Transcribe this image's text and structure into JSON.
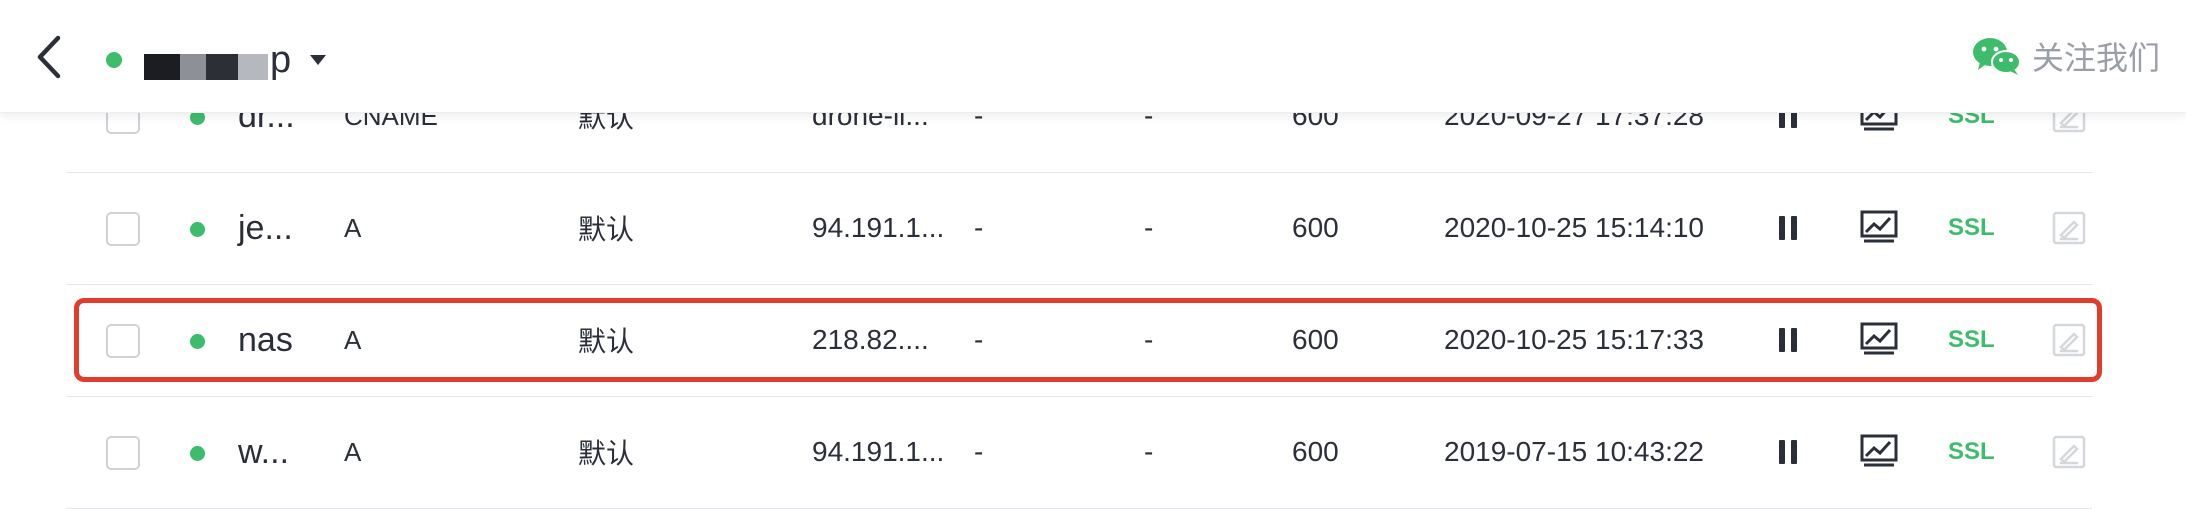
{
  "header": {
    "back_icon": "chevron-left-icon",
    "domain_status_color": "#3dbd6c",
    "domain_visible_suffix": "p",
    "dropdown_icon": "caret-down-icon",
    "follow_icon": "wechat-icon",
    "follow_label": "关注我们"
  },
  "records": [
    {
      "host": "dr...",
      "type": "CNAME",
      "line": "默认",
      "value": "drone-li...",
      "mx": "-",
      "weight": "-",
      "ttl": "600",
      "updated": "2020-09-27 17:37:28",
      "status": "enabled",
      "ssl": "SSL"
    },
    {
      "host": "je...",
      "type": "A",
      "line": "默认",
      "value": "94.191.1...",
      "mx": "-",
      "weight": "-",
      "ttl": "600",
      "updated": "2020-10-25 15:14:10",
      "status": "enabled",
      "ssl": "SSL"
    },
    {
      "host": "nas",
      "type": "A",
      "line": "默认",
      "value": "218.82....",
      "mx": "-",
      "weight": "-",
      "ttl": "600",
      "updated": "2020-10-25 15:17:33",
      "status": "enabled",
      "ssl": "SSL",
      "highlighted": true
    },
    {
      "host": "w...",
      "type": "A",
      "line": "默认",
      "value": "94.191.1...",
      "mx": "-",
      "weight": "-",
      "ttl": "600",
      "updated": "2019-07-15 10:43:22",
      "status": "enabled",
      "ssl": "SSL"
    }
  ],
  "colors": {
    "accent_green": "#3dbd6c",
    "highlight_border": "#e03d2c",
    "text": "#2b2f3a",
    "muted": "#9a9ea6"
  }
}
